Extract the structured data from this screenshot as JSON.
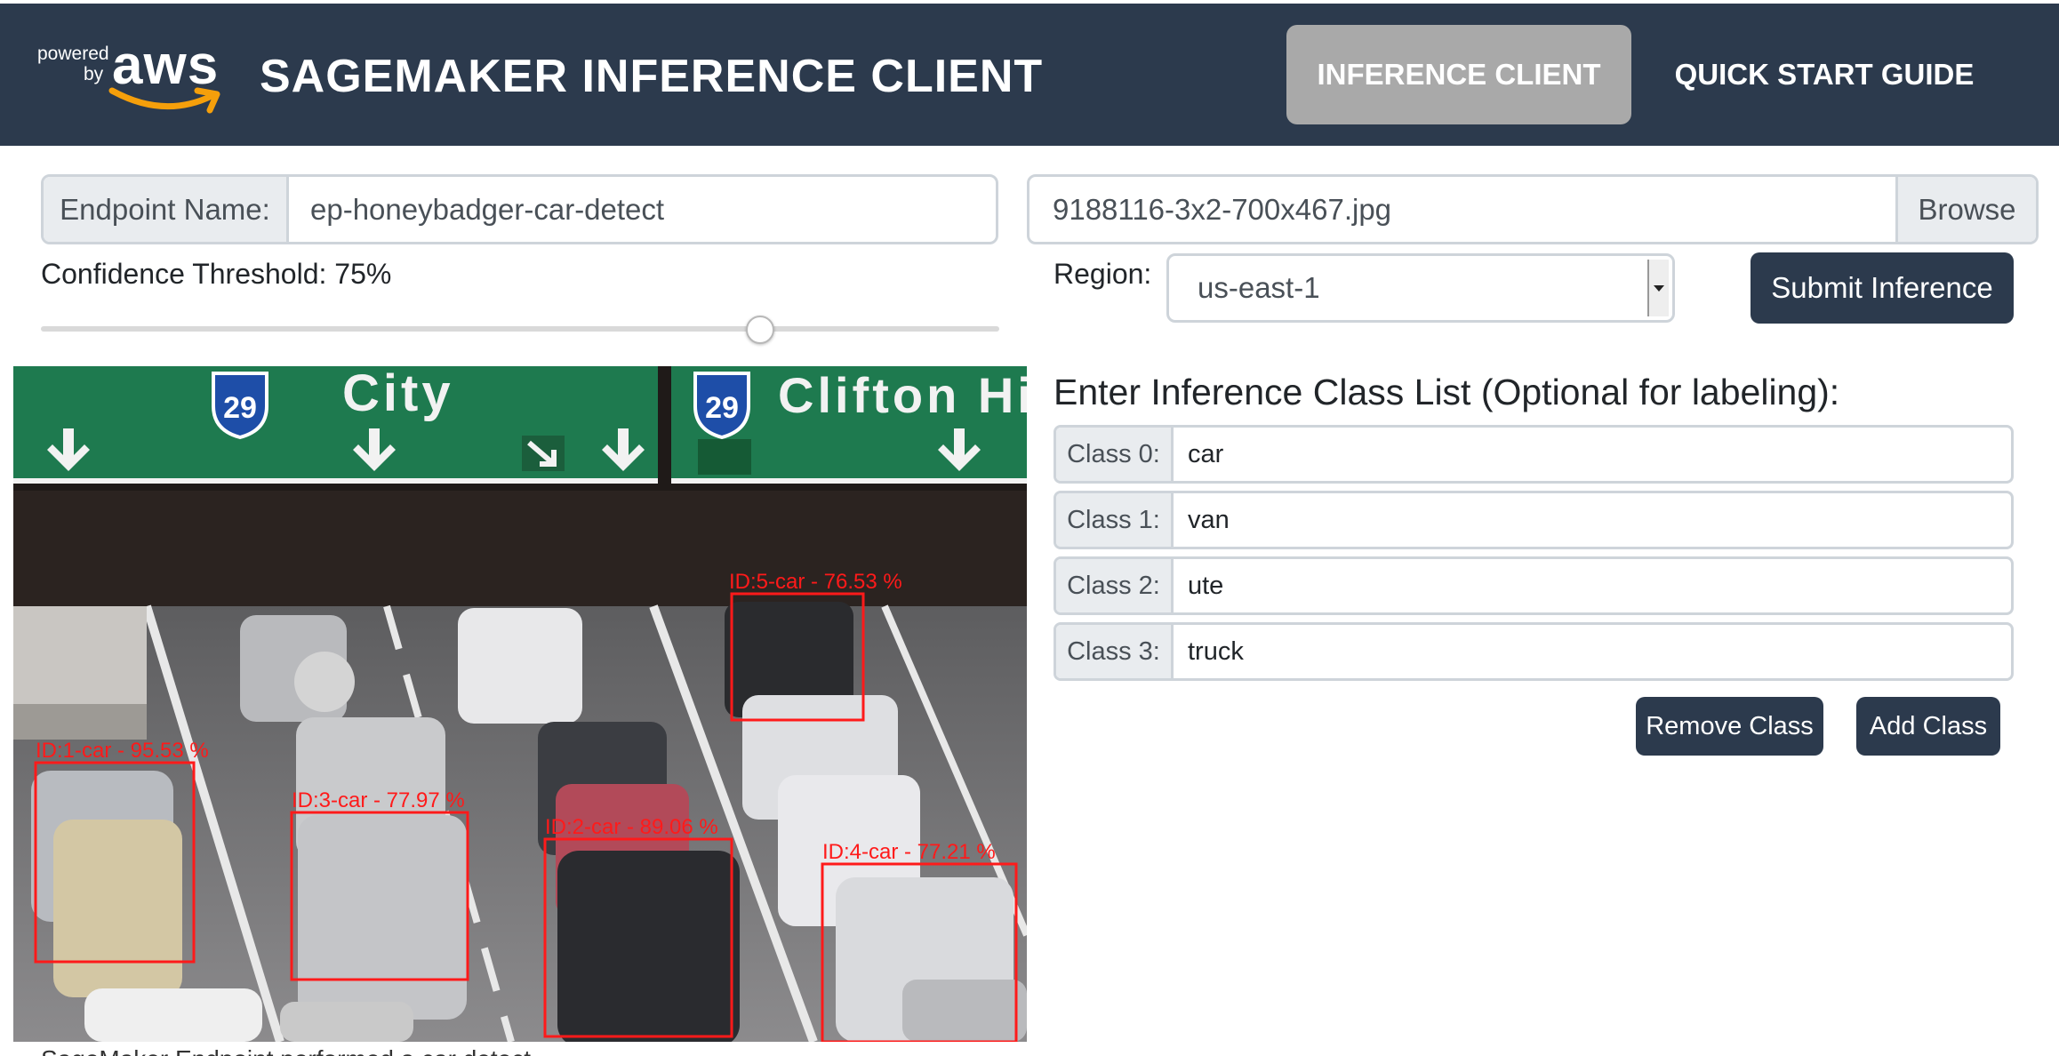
{
  "header": {
    "logo": {
      "powered": "powered",
      "by": "by",
      "aws": "aws"
    },
    "title": "SAGEMAKER INFERENCE CLIENT",
    "nav": [
      {
        "label": "INFERENCE CLIENT",
        "active": true
      },
      {
        "label": "QUICK START GUIDE",
        "active": false
      }
    ]
  },
  "endpoint": {
    "label": "Endpoint Name:",
    "value": "ep-honeybadger-car-detect"
  },
  "file": {
    "name": "9188116-3x2-700x467.jpg",
    "browse_label": "Browse"
  },
  "threshold": {
    "label": "Confidence Threshold: 75%",
    "value": 75
  },
  "region": {
    "label": "Region:",
    "selected": "us-east-1"
  },
  "submit_label": "Submit Inference",
  "classes": {
    "heading": "Enter Inference Class List (Optional for labeling):",
    "items": [
      {
        "label": "Class 0:",
        "value": "car"
      },
      {
        "label": "Class 1:",
        "value": "van"
      },
      {
        "label": "Class 2:",
        "value": "ute"
      },
      {
        "label": "Class 3:",
        "value": "truck"
      }
    ],
    "remove_label": "Remove Class",
    "add_label": "Add Class"
  },
  "image": {
    "signs": [
      {
        "route": "29",
        "name": "City"
      },
      {
        "route": "29",
        "name": "Clifton Hill"
      }
    ],
    "detections": [
      {
        "label": "ID:1-car - 95.53 %"
      },
      {
        "label": "ID:2-car - 89.06 %"
      },
      {
        "label": "ID:3-car - 77.97 %"
      },
      {
        "label": "ID:4-car - 77.21 %"
      },
      {
        "label": "ID:5-car - 76.53 %"
      }
    ]
  },
  "caption": "SageMaker Endpoint performed a car detect",
  "colors": {
    "header_bg": "#2c3a4d",
    "nav_active_bg": "#a9a9a9",
    "button_bg": "#2c3a4d",
    "sign_green": "#1e7a4f",
    "detection_box": "#ff1a1a"
  }
}
